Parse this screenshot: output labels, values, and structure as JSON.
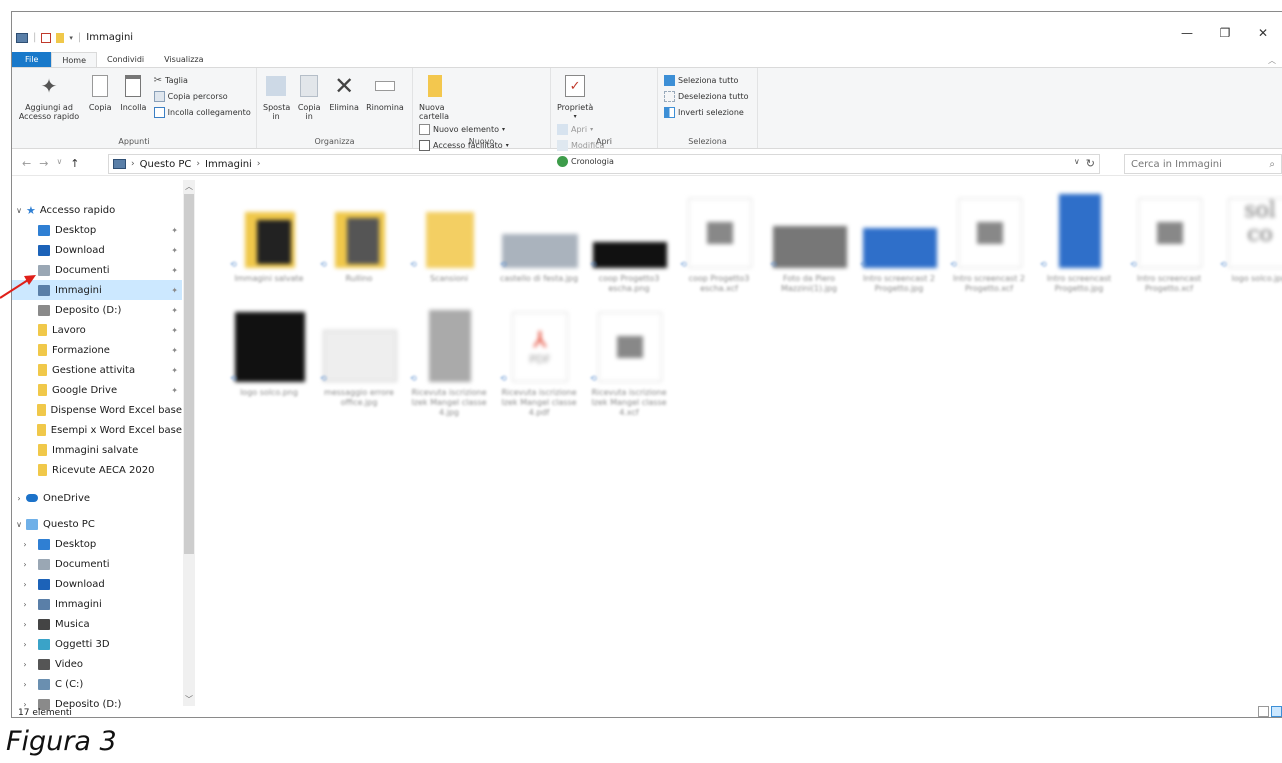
{
  "window": {
    "title": "Immagini",
    "controls": {
      "minimize": "—",
      "maximize": "❐",
      "close": "✕"
    }
  },
  "tabs": [
    {
      "label": "File"
    },
    {
      "label": "Home"
    },
    {
      "label": "Condividi"
    },
    {
      "label": "Visualizza"
    }
  ],
  "ribbon": {
    "appunti": {
      "name": "Appunti",
      "pin": "Aggiungi ad Accesso rapido",
      "copy": "Copia",
      "paste": "Incolla",
      "cut": "Taglia",
      "copy_path": "Copia percorso",
      "paste_link": "Incolla collegamento"
    },
    "organizza": {
      "name": "Organizza",
      "move": "Sposta in",
      "copy_to": "Copia in",
      "delete": "Elimina",
      "rename": "Rinomina"
    },
    "nuovo": {
      "name": "Nuovo",
      "new_folder": "Nuova cartella",
      "new_item": "Nuovo elemento",
      "easy_access": "Accesso facilitato"
    },
    "apri": {
      "name": "Apri",
      "properties": "Proprietà",
      "open": "Apri",
      "edit": "Modifica",
      "history": "Cronologia"
    },
    "seleziona": {
      "name": "Seleziona",
      "select_all": "Seleziona tutto",
      "select_none": "Deseleziona tutto",
      "invert": "Inverti selezione"
    }
  },
  "address": {
    "crumbs": [
      "Questo PC",
      "Immagini"
    ],
    "search_placeholder": "Cerca in Immagini"
  },
  "navpane": {
    "quick_access": "Accesso rapido",
    "items": [
      {
        "label": "Desktop",
        "pinned": true
      },
      {
        "label": "Download",
        "pinned": true
      },
      {
        "label": "Documenti",
        "pinned": true
      },
      {
        "label": "Immagini",
        "pinned": true,
        "selected": true
      },
      {
        "label": "Deposito (D:)",
        "pinned": true
      },
      {
        "label": "Lavoro",
        "pinned": true
      },
      {
        "label": "Formazione",
        "pinned": true
      },
      {
        "label": "Gestione attivita",
        "pinned": true
      },
      {
        "label": "Google Drive",
        "pinned": true
      },
      {
        "label": "Dispense Word Excel base"
      },
      {
        "label": "Esempi x Word Excel base"
      },
      {
        "label": "Immagini salvate"
      },
      {
        "label": "Ricevute AECA 2020"
      }
    ],
    "onedrive": "OneDrive",
    "this_pc": "Questo PC",
    "pc_items": [
      {
        "label": "Desktop"
      },
      {
        "label": "Documenti"
      },
      {
        "label": "Download"
      },
      {
        "label": "Immagini"
      },
      {
        "label": "Musica"
      },
      {
        "label": "Oggetti 3D"
      },
      {
        "label": "Video"
      },
      {
        "label": "C (C:)"
      },
      {
        "label": "Deposito (D:)"
      }
    ]
  },
  "files": [
    {
      "name": "Immagini salvate",
      "kind": "folder-doc"
    },
    {
      "name": "Rullino",
      "kind": "folder-photo"
    },
    {
      "name": "Scansioni",
      "kind": "folder"
    },
    {
      "name": "castello di festa.jpg",
      "kind": "image-web"
    },
    {
      "name": "coop Progetto3 escha.png",
      "kind": "image-dark"
    },
    {
      "name": "coop Progetto3 escha.xcf",
      "kind": "xcf"
    },
    {
      "name": "Foto da Piero Mazzini(1).jpg",
      "kind": "image-gray"
    },
    {
      "name": "Intro screencast 2 Progetto.jpg",
      "kind": "image-blue"
    },
    {
      "name": "Intro screencast 2 Progetto.xcf",
      "kind": "xcf"
    },
    {
      "name": "Intro screencast Progetto.jpg",
      "kind": "image-bluetall"
    },
    {
      "name": "Intro screencast Progetto.xcf",
      "kind": "xcf"
    },
    {
      "name": "logo solco.jpg",
      "kind": "logo-light"
    },
    {
      "name": "logo solco.png",
      "kind": "logo-dark"
    },
    {
      "name": "messaggio errore office.jpg",
      "kind": "image-dialog"
    },
    {
      "name": "Ricevuta iscrizione Izek Mangel classe 4.jpg",
      "kind": "image-receipt"
    },
    {
      "name": "Ricevuta iscrizione Izek Mangel classe 4.pdf",
      "kind": "pdf"
    },
    {
      "name": "Ricevuta iscrizione Izek Mangel classe 4.xcf",
      "kind": "xcf"
    }
  ],
  "status": {
    "count": "17 elementi"
  },
  "caption": "Figura 3"
}
